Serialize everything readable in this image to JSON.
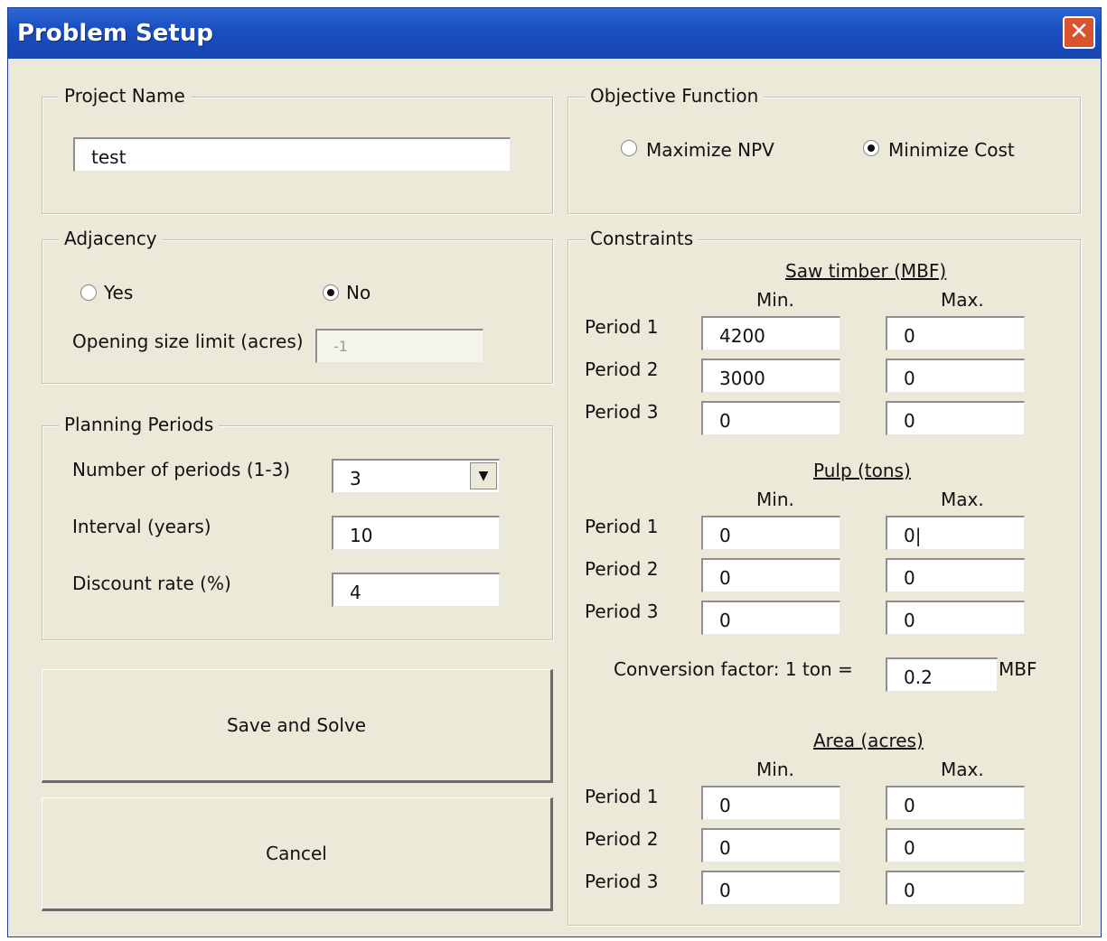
{
  "window": {
    "title": "Problem Setup",
    "close_glyph": "✕"
  },
  "project": {
    "legend": "Project Name",
    "value": "test"
  },
  "adjacency": {
    "legend": "Adjacency",
    "yes_label": "Yes",
    "no_label": "No",
    "selected": "No",
    "opening_label": "Opening size limit (acres)",
    "opening_value": "-1"
  },
  "planning": {
    "legend": "Planning Periods",
    "num_label": "Number of periods (1-3)",
    "num_value": "3",
    "interval_label": "Interval (years)",
    "interval_value": "10",
    "discount_label": "Discount rate (%)",
    "discount_value": "4",
    "dropdown_glyph": "▼"
  },
  "buttons": {
    "save_solve": "Save and Solve",
    "cancel": "Cancel"
  },
  "objective": {
    "legend": "Objective Function",
    "maximize_label": "Maximize NPV",
    "minimize_label": "Minimize Cost",
    "selected": "Minimize Cost"
  },
  "constraints": {
    "legend": "Constraints",
    "min_label": "Min.",
    "max_label": "Max.",
    "saw": {
      "title": "Saw timber (MBF)",
      "rows": [
        {
          "period": "Period 1",
          "min": "4200",
          "max": "0"
        },
        {
          "period": "Period 2",
          "min": "3000",
          "max": "0"
        },
        {
          "period": "Period 3",
          "min": "0",
          "max": "0"
        }
      ]
    },
    "pulp": {
      "title": "Pulp (tons)",
      "rows": [
        {
          "period": "Period 1",
          "min": "0",
          "max": "0|"
        },
        {
          "period": "Period 2",
          "min": "0",
          "max": "0"
        },
        {
          "period": "Period 3",
          "min": "0",
          "max": "0"
        }
      ]
    },
    "conversion": {
      "label": "Conversion factor:  1 ton  =",
      "value": "0.2",
      "unit": "MBF"
    },
    "area": {
      "title": "Area (acres)",
      "rows": [
        {
          "period": "Period 1",
          "min": "0",
          "max": "0"
        },
        {
          "period": "Period 2",
          "min": "0",
          "max": "0"
        },
        {
          "period": "Period 3",
          "min": "0",
          "max": "0"
        }
      ]
    }
  }
}
